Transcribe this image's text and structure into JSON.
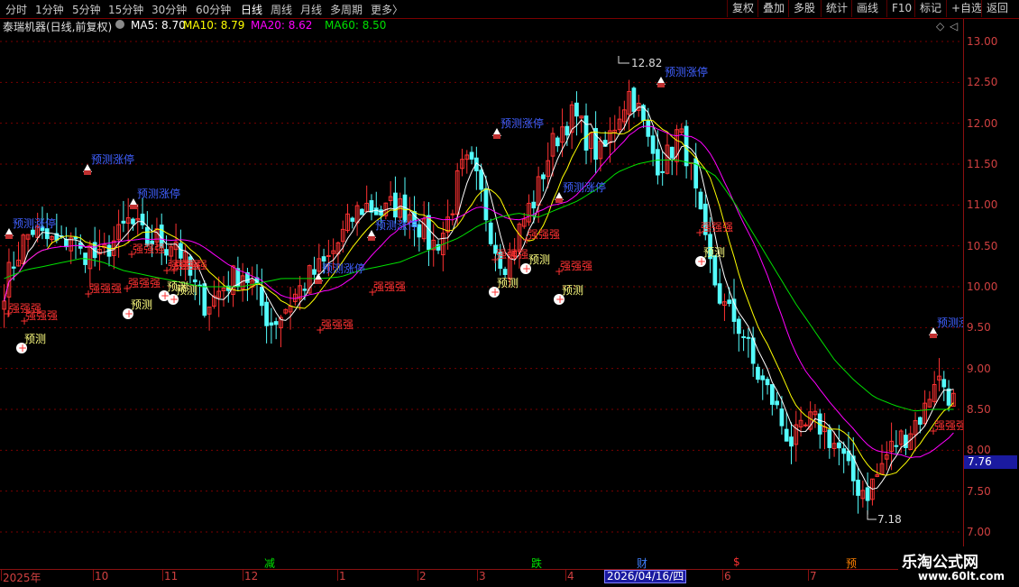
{
  "toolbar": {
    "periods": [
      "分时",
      "1分钟",
      "5分钟",
      "15分钟",
      "30分钟",
      "60分钟",
      "日线",
      "周线",
      "月线",
      "多周期",
      "更多"
    ],
    "active_period": "日线",
    "more_arrow": "〉",
    "right_buttons": [
      "复权",
      "叠加",
      "多股",
      "统计",
      "画线",
      "F10",
      "标记",
      "+自选",
      "返回"
    ]
  },
  "info": {
    "title": "泰瑞机器(日线,前复权)",
    "ma5": "MA5: 8.70",
    "ma10": "MA10: 8.79",
    "ma20": "MA20: 8.62",
    "ma60": "MA60: 8.50"
  },
  "colors": {
    "up": "#ff3232",
    "down": "#54fcfc",
    "ma5": "#ffffff",
    "ma10": "#ffff00",
    "ma20": "#ff00ff",
    "ma60": "#00e000",
    "grid": "#7a0000",
    "axis_text": "#d04040"
  },
  "chart_data": {
    "type": "candlestick",
    "y_ticks": [
      "13.00",
      "12.50",
      "12.00",
      "11.50",
      "11.00",
      "10.50",
      "10.00",
      "9.50",
      "9.00",
      "8.50",
      "8.00",
      "7.50",
      "7.00"
    ],
    "ylim": [
      6.88,
      13.12
    ],
    "current_price": "7.76",
    "high_label": "12.82",
    "low_label": "7.18",
    "x_ticks": [
      "2025年",
      "10",
      "11",
      "12",
      "1",
      "2",
      "3",
      "4",
      "5",
      "6",
      "7"
    ],
    "cursor_date": "2026/04/16/四",
    "events": [
      {
        "label": "减",
        "color": "#00e000"
      },
      {
        "label": "跌",
        "color": "#00e000"
      },
      {
        "label": "财",
        "color": "#4080ff"
      },
      {
        "label": "$",
        "color": "#ff3232"
      },
      {
        "label": "预",
        "color": "#ff8000"
      }
    ],
    "close_path": [
      10.0,
      10.3,
      10.55,
      10.7,
      10.6,
      10.55,
      10.5,
      10.65,
      10.4,
      10.45,
      10.3,
      10.5,
      10.6,
      10.8,
      10.7,
      10.55,
      10.6,
      10.5,
      10.6,
      10.3,
      10.0,
      9.8,
      9.85,
      10.0,
      10.1,
      10.2,
      10.05,
      9.8,
      9.55,
      9.65,
      9.8,
      9.95,
      10.1,
      10.2,
      10.3,
      10.5,
      10.7,
      10.9,
      11.0,
      10.95,
      10.9,
      11.0,
      10.95,
      10.9,
      10.7,
      10.5,
      10.6,
      10.9,
      11.4,
      11.5,
      11.2,
      10.8,
      10.4,
      10.3,
      10.6,
      10.9,
      11.1,
      11.5,
      11.8,
      12.0,
      12.1,
      11.9,
      11.7,
      11.6,
      11.9,
      12.2,
      12.4,
      12.1,
      11.7,
      11.5,
      11.6,
      11.9,
      11.6,
      11.0,
      10.4,
      10.0,
      9.7,
      9.6,
      9.4,
      9.0,
      8.8,
      8.6,
      8.3,
      8.1,
      8.2,
      8.35,
      8.3,
      8.15,
      8.0,
      7.7,
      7.55,
      7.5,
      7.7,
      7.95,
      8.1,
      8.2,
      8.35,
      8.5,
      8.9,
      8.8,
      8.6
    ],
    "ma60_path": [
      10.1,
      10.2,
      10.25,
      10.3,
      10.35,
      10.3,
      10.2,
      10.15,
      10.1,
      10.05,
      10.0,
      10.0,
      10.0,
      10.05,
      10.1,
      10.1,
      10.1,
      10.12,
      10.2,
      10.25,
      10.3,
      10.4,
      10.5,
      10.6,
      10.75,
      10.85,
      10.9,
      10.85,
      10.95,
      11.05,
      11.2,
      11.4,
      11.5,
      11.55,
      11.55,
      11.5,
      11.35,
      11.0,
      10.6,
      10.2,
      9.8,
      9.45,
      9.1,
      8.85,
      8.65,
      8.55,
      8.48,
      8.5,
      8.5
    ],
    "signals": {
      "limit_up_label": "预测涨停",
      "strong_label": "强强强",
      "predict_label": "预测"
    }
  },
  "brand": {
    "title": "乐淘公式网",
    "url": "www.60lt.com"
  }
}
